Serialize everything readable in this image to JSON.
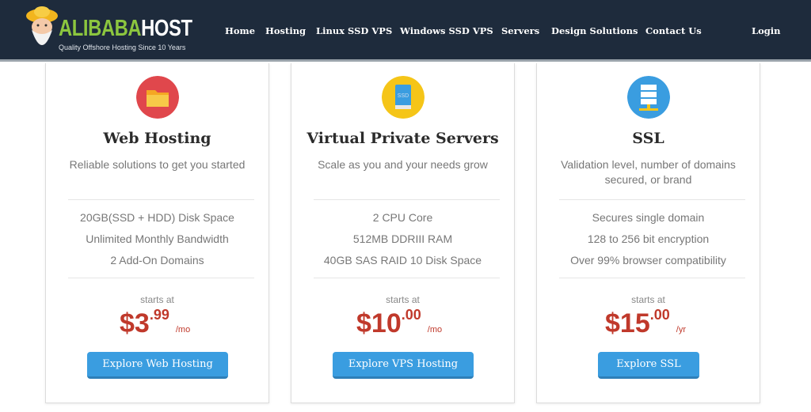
{
  "header": {
    "brand_green": "ALIBABA",
    "brand_white": "HOST",
    "tagline": "Quality Offshore Hosting Since 10 Years",
    "nav": [
      "Home",
      "Hosting",
      "Linux SSD VPS",
      "Windows SSD VPS",
      "Servers",
      "Design Solutions",
      "Contact Us"
    ],
    "login": "Login"
  },
  "colors": {
    "header_bg": "#1e2b3c",
    "brand_green": "#8cc63f",
    "price": "#c0392b",
    "button": "#3a9de0"
  },
  "cards": [
    {
      "icon": "folder-icon",
      "title": "Web Hosting",
      "subtitle": "Reliable solutions to get you started",
      "features": [
        "20GB(SSD + HDD) Disk Space",
        "Unlimited Monthly Bandwidth",
        "2 Add-On Domains"
      ],
      "starts_at": "starts at",
      "price": "$3",
      "cents": ".99",
      "period": "/mo",
      "button": "Explore Web Hosting"
    },
    {
      "icon": "ssd-icon",
      "title": "Virtual Private Servers",
      "subtitle": "Scale as you and your needs grow",
      "features": [
        "2 CPU Core",
        "512MB DDRIII RAM",
        "40GB SAS RAID 10 Disk Space"
      ],
      "starts_at": "starts at",
      "price": "$10",
      "cents": ".00",
      "period": "/mo",
      "button": "Explore VPS Hosting"
    },
    {
      "icon": "server-icon",
      "title": "SSL",
      "subtitle": "Validation level, number of domains secured, or brand",
      "features": [
        "Secures single domain",
        "128 to 256 bit encryption",
        "Over 99% browser compatibility"
      ],
      "starts_at": "starts at",
      "price": "$15",
      "cents": ".00",
      "period": "/yr",
      "button": "Explore SSL"
    }
  ]
}
